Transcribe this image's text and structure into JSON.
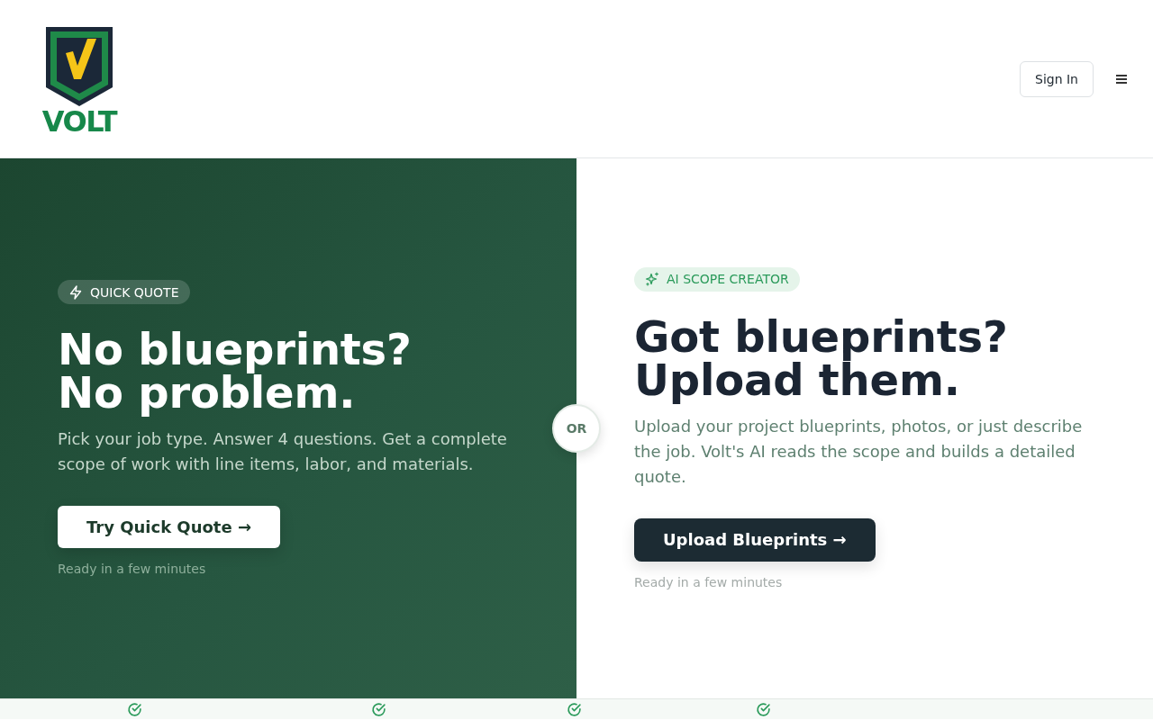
{
  "header": {
    "logo_text": "VOLT",
    "sign_in_button": "Sign In"
  },
  "quick_quote": {
    "badge": "QUICK QUOTE",
    "headline": [
      "No blueprints?",
      "No problem."
    ],
    "description": "Pick your job type. Answer 4 questions. Get a complete scope of work with line items, labor, and materials.",
    "button": "Try Quick Quote →",
    "note": "Ready in a few minutes"
  },
  "divider_label": "OR",
  "ai_scope_creator": {
    "badge": "AI SCOPE CREATOR",
    "headline": [
      "Got blueprints?",
      "Upload them."
    ],
    "description": "Upload your project blueprints, photos, or just describe the job. Volt's AI reads the scope and builds a detailed quote.",
    "button": "Upload Blueprints →",
    "note": "Ready in a few minutes"
  }
}
